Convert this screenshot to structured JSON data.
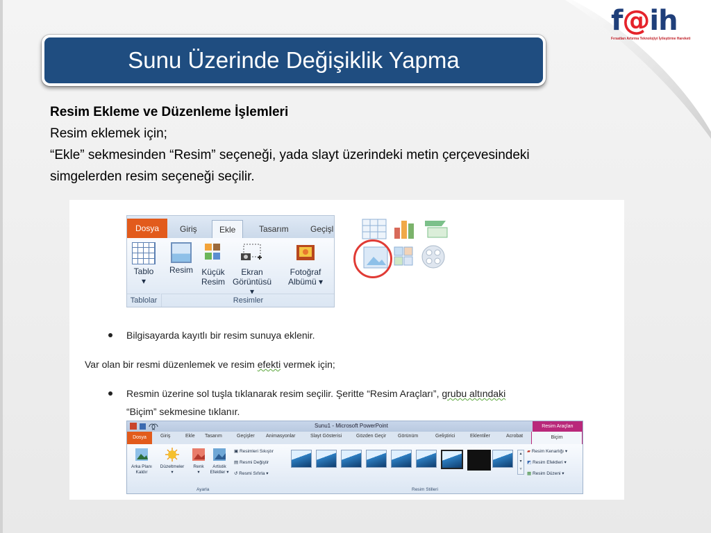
{
  "logo": {
    "main_left": "f",
    "main_at": "@",
    "main_right": "ih",
    "tagline": "Fırsatları Artırma Teknolojiyi İyileştirme Hareketi"
  },
  "slide": {
    "title": "Sunu Üzerinde Değişiklik Yapma",
    "heading": "Resim Ekleme ve Düzenleme İşlemleri",
    "lines": [
      "Resim eklemek için;",
      "“Ekle” sekmesinden “Resim” seçeneği, yada slayt üzerindeki metin çerçevesindeki simgelerden resim seçeneği seçilir."
    ]
  },
  "ribbon1": {
    "tabs": {
      "file": "Dosya",
      "home": "Giriş",
      "insert": "Ekle",
      "design": "Tasarım",
      "transitions": "Geçişl"
    },
    "buttons": {
      "table_l1": "Tablo",
      "table_l2": "▾",
      "picture": "Resim",
      "clipart_l1": "Küçük",
      "clipart_l2": "Resim",
      "screenshot_l1": "Ekran",
      "screenshot_l2": "Görüntüsü ▾",
      "album_l1": "Fotoğraf",
      "album_l2": "Albümü ▾"
    },
    "groups": {
      "tables": "Tablolar",
      "images": "Resimler"
    }
  },
  "doc": {
    "bullet1": "Bilgisayarda kayıtlı bir resim sunuya eklenir.",
    "para_prefix": "Var olan bir resmi düzenlemek ve resim ",
    "para_squig": "efekti",
    "para_suffix": " vermek için;",
    "bullet2_l1a": "Resmin üzerine sol tuşla tıklanarak resim seçilir. Şeritte “Resim Araçları”, ",
    "bullet2_l1b": "grubu  altındaki",
    "bullet2_l2": "“Biçim” sekmesine tıklanır."
  },
  "ribbon2": {
    "window_title": "Sunu1 - Microsoft PowerPoint",
    "context_tab": "Resim Araçları",
    "tabs": [
      "Giriş",
      "Ekle",
      "Tasarım",
      "Geçişler",
      "Animasyonlar",
      "Slayt Gösterisi",
      "Gözden Geçir",
      "Görünüm",
      "Geliştirici",
      "Eklentiler",
      "Acrobat"
    ],
    "file_tab": "Dosya",
    "format_tab": "Biçim",
    "buttons": {
      "remove_bg_l1": "Arka Planı",
      "remove_bg_l2": "Kaldır",
      "corrections": "Düzeltmeler",
      "corrections_arrow": "▾",
      "color": "Renk",
      "color_arrow": "▾",
      "artistic_l1": "Artistik",
      "artistic_l2": "Efektler ▾",
      "compress": "Resimleri Sıkıştır",
      "change": "Resmi Değiştir",
      "reset": "Resmi Sıfırla ▾",
      "border": "Resim Kenarlığı ▾",
      "effects": "Resim Efektleri ▾",
      "layout": "Resim Düzeni ▾"
    },
    "groups": {
      "adjust": "Ayarla",
      "styles": "Resim Stilleri"
    }
  }
}
